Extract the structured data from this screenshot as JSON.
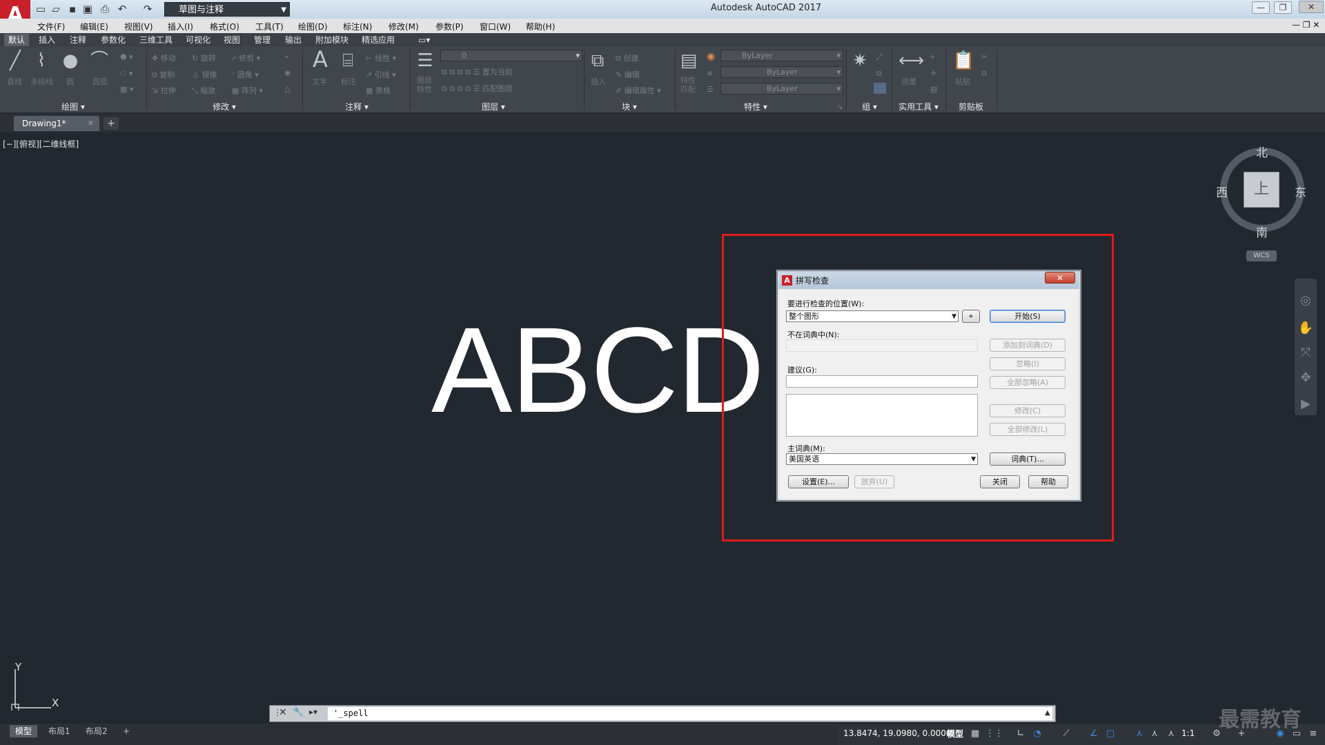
{
  "titlebar": {
    "app_title": "Autodesk AutoCAD 2017",
    "workspace": "草图与注释",
    "qa_icons": [
      "new-icon",
      "open-icon",
      "save-icon",
      "saveas-icon",
      "print-icon",
      "undo-icon",
      "redo-icon"
    ]
  },
  "menu": [
    "文件(F)",
    "编辑(E)",
    "视图(V)",
    "插入(I)",
    "格式(O)",
    "工具(T)",
    "绘图(D)",
    "标注(N)",
    "修改(M)",
    "参数(P)",
    "窗口(W)",
    "帮助(H)"
  ],
  "ribbon_tabs": [
    "默认",
    "插入",
    "注释",
    "参数化",
    "三维工具",
    "可视化",
    "视图",
    "管理",
    "输出",
    "附加模块",
    "精选应用"
  ],
  "ribbon": {
    "panels": [
      "绘图",
      "修改",
      "注释",
      "图层",
      "块",
      "特性",
      "组",
      "实用工具",
      "剪贴板"
    ],
    "draw_tools": [
      "直线",
      "多段线",
      "圆",
      "圆弧"
    ],
    "modify_tools": [
      "移动",
      "旋转",
      "修剪",
      "复制",
      "镜像",
      "圆角",
      "拉伸",
      "缩放",
      "阵列"
    ],
    "annot_tools": [
      "文字",
      "标注",
      "线性",
      "引线",
      "表格"
    ],
    "layer_tools": [
      "图层特性",
      "置为当前",
      "匹配图层"
    ],
    "layer_value": "0",
    "block_tools": [
      "插入",
      "创建",
      "编辑",
      "编辑属性"
    ],
    "prop_tools": [
      "特性匹配"
    ],
    "prop_values": [
      "ByLayer",
      "ByLayer",
      "ByLayer"
    ],
    "util_tools": [
      "测量"
    ],
    "clip_tools": [
      "粘贴"
    ]
  },
  "doc_tab": "Drawing1*",
  "viewport_label": "[−][俯视][二维线框]",
  "canvas_text": "ABCD",
  "viewcube": {
    "north": "北",
    "south": "南",
    "east": "东",
    "west": "西",
    "face": "上",
    "wcs": "WCS"
  },
  "dialog": {
    "title": "拼写检查",
    "where_label": "要进行检查的位置(W):",
    "where_value": "整个图形",
    "start": "开始(S)",
    "not_in_dict_label": "不在词典中(N):",
    "add_dict": "添加到词典(D)",
    "ignore": "忽略(I)",
    "ignore_all": "全部忽略(A)",
    "suggest_label": "建议(G):",
    "change": "修改(C)",
    "change_all": "全部修改(L)",
    "main_dict_label": "主词典(M):",
    "main_dict_value": "美国英语",
    "dictionaries": "词典(T)...",
    "settings": "设置(E)...",
    "undo": "放弃(U)",
    "close": "关闭",
    "help": "帮助"
  },
  "command_line": "'_spell",
  "layout_tabs": [
    "模型",
    "布局1",
    "布局2"
  ],
  "status": {
    "coords": "13.8474, 19.0980, 0.0000",
    "model": "模型",
    "scale": "1:1"
  },
  "watermark": "最需教育"
}
